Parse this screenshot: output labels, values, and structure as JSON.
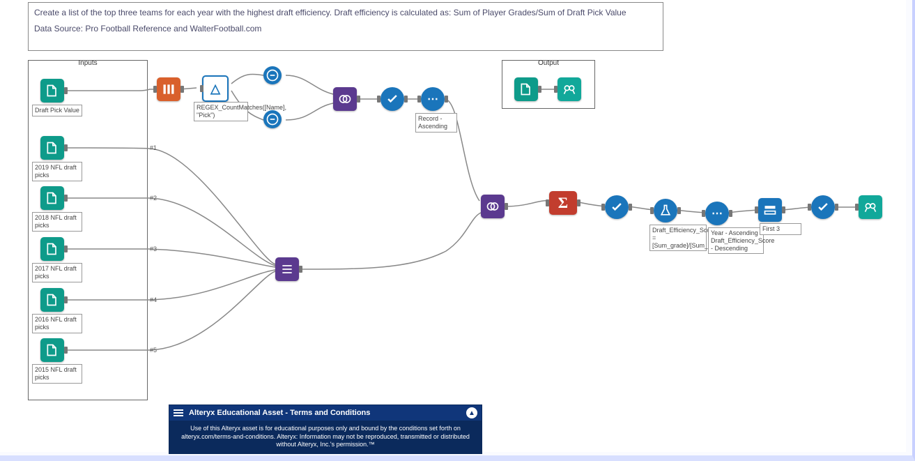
{
  "commentBox": {
    "line1": "Create a list of the top three teams for each year with the highest draft efficiency.  Draft efficiency is calculated as:   Sum of Player Grades/Sum of Draft Pick Value",
    "line2": "Data Source: Pro Football Reference and WalterFootball.com"
  },
  "containers": {
    "inputs_title": "Inputs",
    "output_title": "Output"
  },
  "inputs": [
    {
      "label": "Draft Pick Value"
    },
    {
      "label": "2019 NFL draft picks"
    },
    {
      "label": "2018 NFL draft picks"
    },
    {
      "label": "2017 NFL draft picks"
    },
    {
      "label": "2016 NFL draft picks"
    },
    {
      "label": "2015 NFL draft picks"
    }
  ],
  "inputPorts": [
    "#1",
    "#2",
    "#3",
    "#4",
    "#5"
  ],
  "annotations": {
    "regex": "REGEX_CountMatches([Name], \"Pick\")",
    "recordid": "Record - Ascending",
    "draft_eff": "Draft_Efficiency_Score = [Sum_grade]/[Sum_Value]",
    "sort2": "Year - Ascending\nDraft_Efficiency_Score - Descending",
    "sample": "First 3"
  },
  "footer": {
    "title": "Alteryx Educational Asset - Terms and Conditions",
    "body": "Use of this Alteryx asset is for educational purposes only and bound by the conditions set forth on alteryx.com/terms-and-conditions. Alteryx: Information may not be reproduced, transmitted or distributed without Alteryx, Inc.'s permission.™"
  },
  "icons": {
    "input": "book-icon",
    "browse": "binoculars-icon",
    "text2cols": "columns-icon",
    "formulaA": "formula-icon",
    "select": "select-icon",
    "sort": "sort-icon",
    "recordid": "record-id-icon",
    "join": "join-icon",
    "union": "union-icon",
    "summarize": "sigma-icon",
    "formulaFlask": "flask-icon",
    "sample": "sample-icon",
    "filter": "filter-icon"
  }
}
